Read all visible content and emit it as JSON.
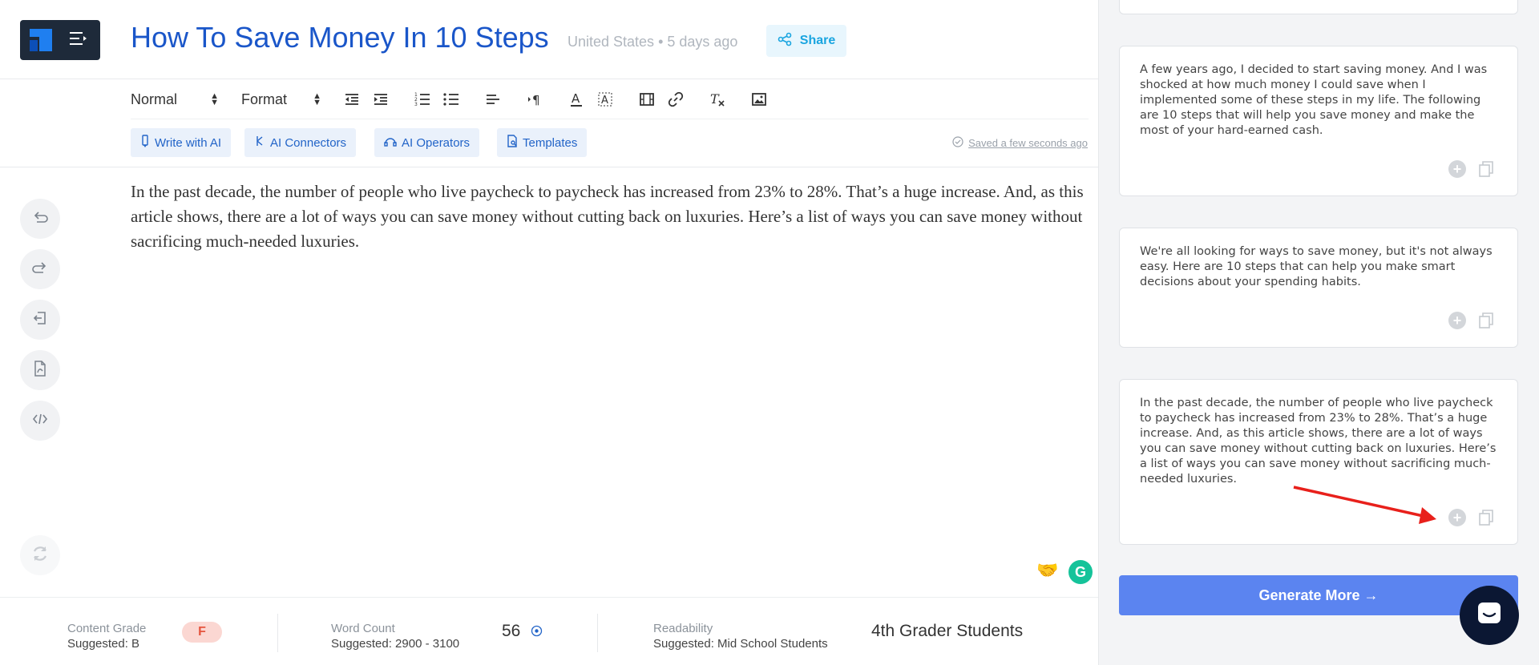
{
  "document": {
    "title": "How To Save Money In 10 Steps",
    "meta": "United States • 5 days ago",
    "share_label": "Share"
  },
  "toolbar": {
    "paragraph_style": "Normal",
    "format_label": "Format",
    "icons": [
      "outdent-icon",
      "indent-icon",
      "ordered-list-icon",
      "bullet-list-icon",
      "align-icon",
      "text-direction-icon",
      "font-color-icon",
      "highlight-icon",
      "video-icon",
      "link-icon",
      "clear-format-icon",
      "image-icon"
    ]
  },
  "ai_tools": {
    "write_with_ai": "Write with AI",
    "ai_connectors": "AI Connectors",
    "ai_operators": "AI Operators",
    "templates": "Templates",
    "saved_status": "Saved a few seconds ago"
  },
  "editor": {
    "body": "In the past decade, the number of people who live paycheck to paycheck has increased from 23% to 28%. That’s a huge increase. And, as this article shows, there are a lot of ways you can save money without cutting back on luxuries. Here’s a list of ways you can save money without sacrificing much-needed luxuries."
  },
  "left_rail": [
    "undo-icon",
    "redo-icon",
    "exit-icon",
    "pdf-icon",
    "code-icon",
    "refresh-icon"
  ],
  "metrics": {
    "content_grade": {
      "label": "Content Grade",
      "suggested": "Suggested: B",
      "value": "F"
    },
    "word_count": {
      "label": "Word Count",
      "suggested": "Suggested: 2900 - 3100",
      "value": "56"
    },
    "readability": {
      "label": "Readability",
      "suggested": "Suggested: Mid School Students",
      "value": "4th Grader Students"
    }
  },
  "suggestions": [
    {
      "text": "A few years ago, I decided to start saving money. And I was shocked at how much money I could save when I implemented some of these steps in my life. The following are 10 steps that will help you save money and make the most of your hard-earned cash."
    },
    {
      "text": "We're all looking for ways to save money, but it's not always easy. Here are 10 steps that can help you make smart decisions about your spending habits."
    },
    {
      "text": "In the past decade, the number of people who live paycheck to paycheck has increased from 23% to 28%. That’s a huge increase. And, as this article shows, there are a lot of ways you can save money without cutting back on luxuries. Here’s a list of ways you can save money without sacrificing much-needed luxuries."
    }
  ],
  "generate_more_label": "Generate More →",
  "colors": {
    "title_blue": "#1a56c9",
    "generate_button": "#5b84f0",
    "grade_badge_bg": "#fbd7d2",
    "grade_badge_text": "#e5553e",
    "annotation_arrow": "#e8201b"
  }
}
